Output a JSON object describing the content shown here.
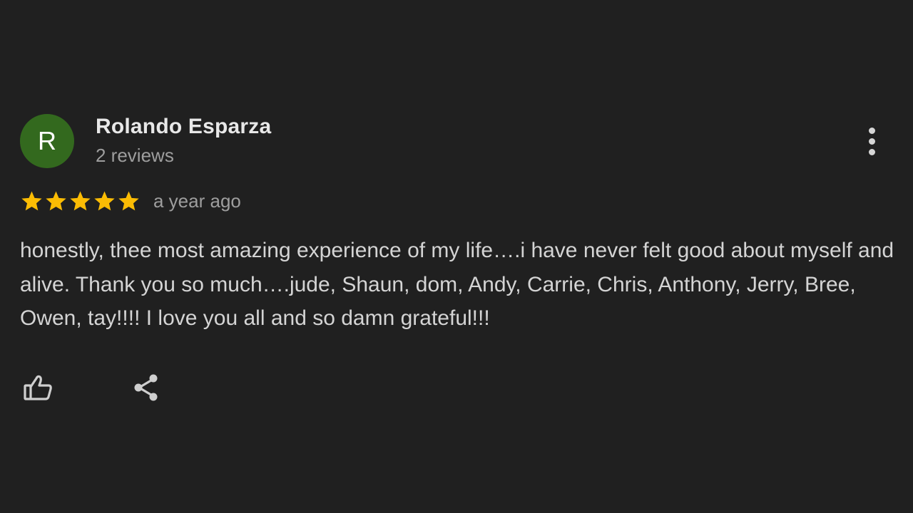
{
  "review": {
    "author": {
      "initial": "R",
      "name": "Rolando Esparza",
      "meta": "2 reviews",
      "avatar_color": "#33691e"
    },
    "rating": {
      "stars": 5,
      "max_stars": 5,
      "star_color": "#fbbc04",
      "time": "a year ago"
    },
    "text": "honestly, thee most amazing experience of my life….i have never felt good about myself and alive. Thank you so much….jude, Shaun, dom, Andy, Carrie, Chris, Anthony, Jerry, Bree, Owen, tay!!!! I love you all and so damn grateful!!!",
    "actions": {
      "like_icon": "thumb-up-outline-icon",
      "share_icon": "share-icon",
      "more_icon": "more-vertical-icon"
    }
  },
  "theme": {
    "background": "#202020",
    "primary_text": "#e8e8e8",
    "secondary_text": "#9e9e9e",
    "body_text": "#d4d4d4"
  }
}
